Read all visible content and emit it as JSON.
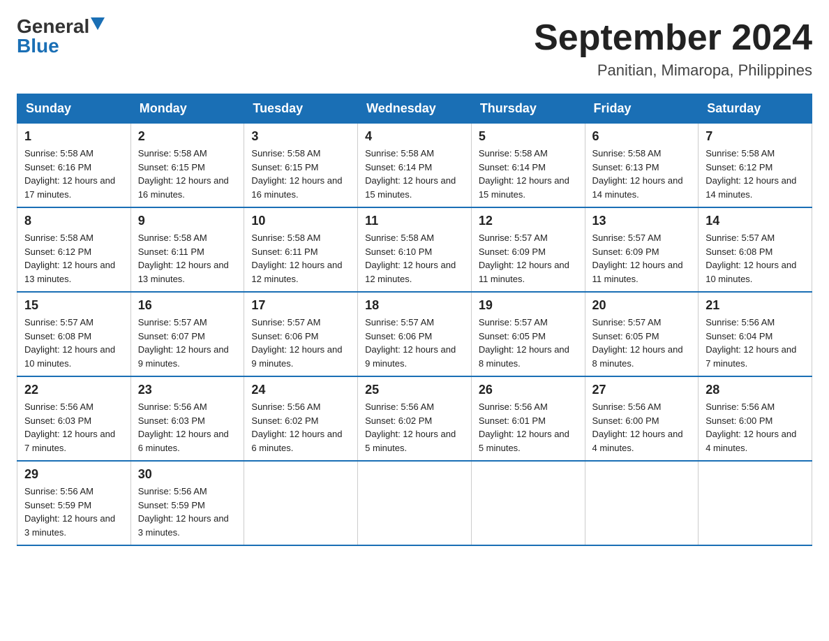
{
  "logo": {
    "general": "General",
    "blue": "Blue"
  },
  "title": "September 2024",
  "location": "Panitian, Mimaropa, Philippines",
  "headers": [
    "Sunday",
    "Monday",
    "Tuesday",
    "Wednesday",
    "Thursday",
    "Friday",
    "Saturday"
  ],
  "weeks": [
    [
      {
        "day": "1",
        "sunrise": "5:58 AM",
        "sunset": "6:16 PM",
        "daylight": "12 hours and 17 minutes."
      },
      {
        "day": "2",
        "sunrise": "5:58 AM",
        "sunset": "6:15 PM",
        "daylight": "12 hours and 16 minutes."
      },
      {
        "day": "3",
        "sunrise": "5:58 AM",
        "sunset": "6:15 PM",
        "daylight": "12 hours and 16 minutes."
      },
      {
        "day": "4",
        "sunrise": "5:58 AM",
        "sunset": "6:14 PM",
        "daylight": "12 hours and 15 minutes."
      },
      {
        "day": "5",
        "sunrise": "5:58 AM",
        "sunset": "6:14 PM",
        "daylight": "12 hours and 15 minutes."
      },
      {
        "day": "6",
        "sunrise": "5:58 AM",
        "sunset": "6:13 PM",
        "daylight": "12 hours and 14 minutes."
      },
      {
        "day": "7",
        "sunrise": "5:58 AM",
        "sunset": "6:12 PM",
        "daylight": "12 hours and 14 minutes."
      }
    ],
    [
      {
        "day": "8",
        "sunrise": "5:58 AM",
        "sunset": "6:12 PM",
        "daylight": "12 hours and 13 minutes."
      },
      {
        "day": "9",
        "sunrise": "5:58 AM",
        "sunset": "6:11 PM",
        "daylight": "12 hours and 13 minutes."
      },
      {
        "day": "10",
        "sunrise": "5:58 AM",
        "sunset": "6:11 PM",
        "daylight": "12 hours and 12 minutes."
      },
      {
        "day": "11",
        "sunrise": "5:58 AM",
        "sunset": "6:10 PM",
        "daylight": "12 hours and 12 minutes."
      },
      {
        "day": "12",
        "sunrise": "5:57 AM",
        "sunset": "6:09 PM",
        "daylight": "12 hours and 11 minutes."
      },
      {
        "day": "13",
        "sunrise": "5:57 AM",
        "sunset": "6:09 PM",
        "daylight": "12 hours and 11 minutes."
      },
      {
        "day": "14",
        "sunrise": "5:57 AM",
        "sunset": "6:08 PM",
        "daylight": "12 hours and 10 minutes."
      }
    ],
    [
      {
        "day": "15",
        "sunrise": "5:57 AM",
        "sunset": "6:08 PM",
        "daylight": "12 hours and 10 minutes."
      },
      {
        "day": "16",
        "sunrise": "5:57 AM",
        "sunset": "6:07 PM",
        "daylight": "12 hours and 9 minutes."
      },
      {
        "day": "17",
        "sunrise": "5:57 AM",
        "sunset": "6:06 PM",
        "daylight": "12 hours and 9 minutes."
      },
      {
        "day": "18",
        "sunrise": "5:57 AM",
        "sunset": "6:06 PM",
        "daylight": "12 hours and 9 minutes."
      },
      {
        "day": "19",
        "sunrise": "5:57 AM",
        "sunset": "6:05 PM",
        "daylight": "12 hours and 8 minutes."
      },
      {
        "day": "20",
        "sunrise": "5:57 AM",
        "sunset": "6:05 PM",
        "daylight": "12 hours and 8 minutes."
      },
      {
        "day": "21",
        "sunrise": "5:56 AM",
        "sunset": "6:04 PM",
        "daylight": "12 hours and 7 minutes."
      }
    ],
    [
      {
        "day": "22",
        "sunrise": "5:56 AM",
        "sunset": "6:03 PM",
        "daylight": "12 hours and 7 minutes."
      },
      {
        "day": "23",
        "sunrise": "5:56 AM",
        "sunset": "6:03 PM",
        "daylight": "12 hours and 6 minutes."
      },
      {
        "day": "24",
        "sunrise": "5:56 AM",
        "sunset": "6:02 PM",
        "daylight": "12 hours and 6 minutes."
      },
      {
        "day": "25",
        "sunrise": "5:56 AM",
        "sunset": "6:02 PM",
        "daylight": "12 hours and 5 minutes."
      },
      {
        "day": "26",
        "sunrise": "5:56 AM",
        "sunset": "6:01 PM",
        "daylight": "12 hours and 5 minutes."
      },
      {
        "day": "27",
        "sunrise": "5:56 AM",
        "sunset": "6:00 PM",
        "daylight": "12 hours and 4 minutes."
      },
      {
        "day": "28",
        "sunrise": "5:56 AM",
        "sunset": "6:00 PM",
        "daylight": "12 hours and 4 minutes."
      }
    ],
    [
      {
        "day": "29",
        "sunrise": "5:56 AM",
        "sunset": "5:59 PM",
        "daylight": "12 hours and 3 minutes."
      },
      {
        "day": "30",
        "sunrise": "5:56 AM",
        "sunset": "5:59 PM",
        "daylight": "12 hours and 3 minutes."
      },
      null,
      null,
      null,
      null,
      null
    ]
  ]
}
